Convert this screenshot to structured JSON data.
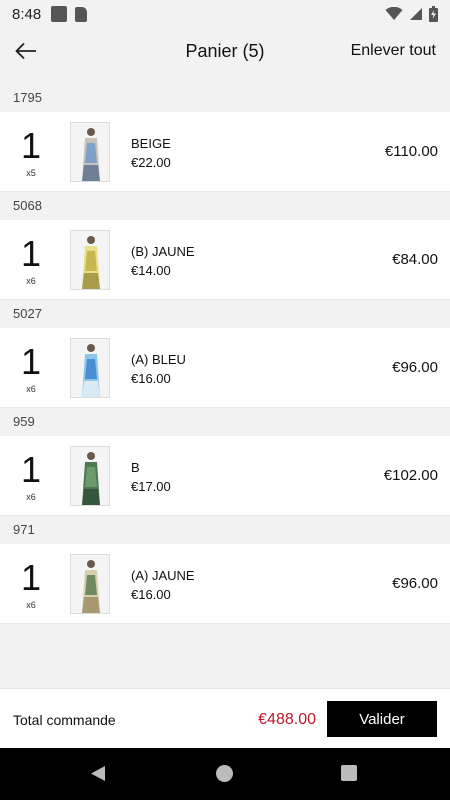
{
  "status_bar": {
    "time": "8:48"
  },
  "header": {
    "title": "Panier (5)",
    "remove_all": "Enlever tout"
  },
  "items": [
    {
      "group": "1795",
      "qty": "1",
      "qty_sub": "x5",
      "name": "BEIGE",
      "unit_price": "€22.00",
      "line_total": "€110.00",
      "colors": [
        "#c8c3b8",
        "#7f9fc8",
        "#5a6e8c"
      ]
    },
    {
      "group": "5068",
      "qty": "1",
      "qty_sub": "x6",
      "name": "(B) JAUNE",
      "unit_price": "€14.00",
      "line_total": "€84.00",
      "colors": [
        "#e7e28a",
        "#c6b84f",
        "#9a8c3b"
      ]
    },
    {
      "group": "5027",
      "qty": "1",
      "qty_sub": "x6",
      "name": "(A) BLEU",
      "unit_price": "€16.00",
      "line_total": "€96.00",
      "colors": [
        "#8fc7ea",
        "#4c8ed2",
        "#e9f2f8"
      ]
    },
    {
      "group": "959",
      "qty": "1",
      "qty_sub": "x6",
      "name": "B",
      "unit_price": "€17.00",
      "line_total": "€102.00",
      "colors": [
        "#4e7a52",
        "#6f9a70",
        "#2f4d36"
      ]
    },
    {
      "group": "971",
      "qty": "1",
      "qty_sub": "x6",
      "name": "(A) JAUNE",
      "unit_price": "€16.00",
      "line_total": "€96.00",
      "colors": [
        "#d8cfae",
        "#6f8a62",
        "#9c8b62"
      ]
    }
  ],
  "footer": {
    "total_label": "Total commande",
    "total_amount": "€488.00",
    "validate_label": "Valider"
  },
  "accent_color": "#c0182a"
}
